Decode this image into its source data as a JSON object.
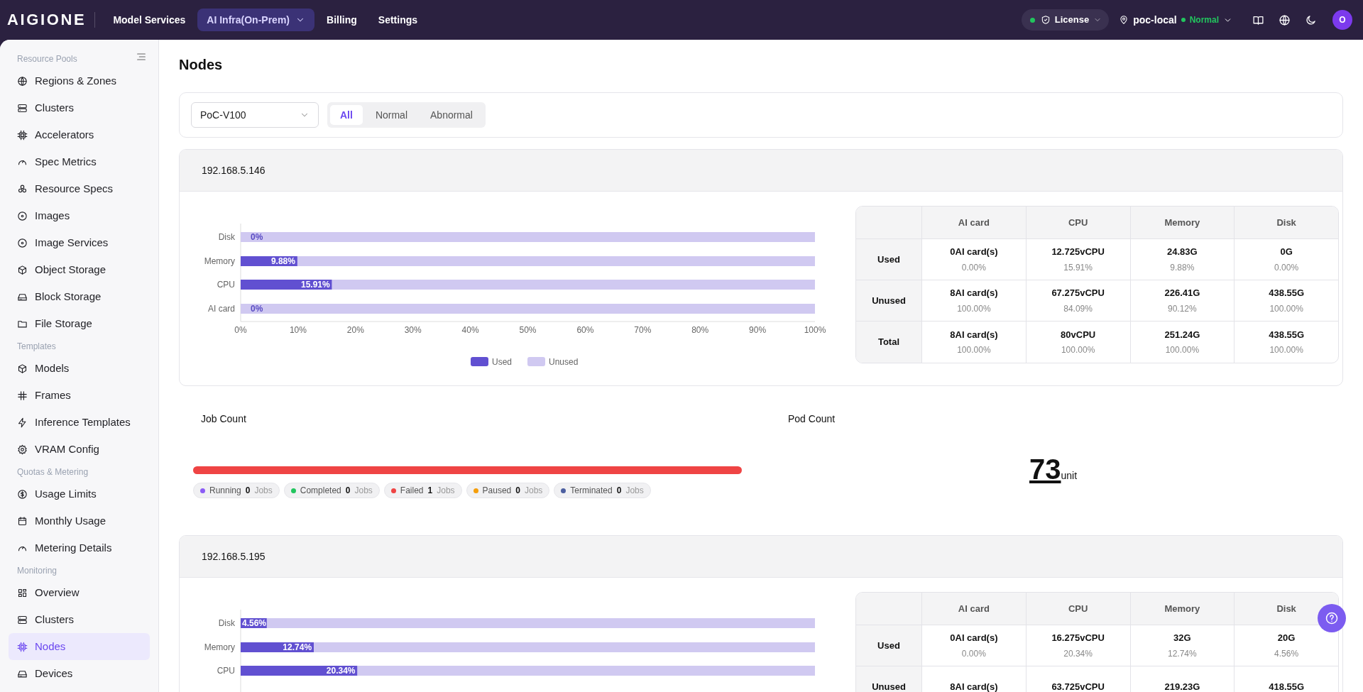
{
  "topbar": {
    "logo": "AIGIONE",
    "nav": [
      {
        "label": "Model Services",
        "selected": false,
        "dropdown": false
      },
      {
        "label": "AI Infra(On-Prem)",
        "selected": true,
        "dropdown": true
      },
      {
        "label": "Billing",
        "selected": false,
        "dropdown": false
      },
      {
        "label": "Settings",
        "selected": false,
        "dropdown": false
      }
    ],
    "license": {
      "label": "License",
      "color": "#22c55e"
    },
    "location": {
      "name": "poc-local",
      "status": "Normal",
      "color": "#22c55e"
    },
    "avatar": "O"
  },
  "sidebar": {
    "sections": [
      {
        "title": "Resource Pools",
        "items": [
          {
            "label": "Regions & Zones",
            "selected": false
          },
          {
            "label": "Clusters",
            "selected": false
          },
          {
            "label": "Accelerators",
            "selected": false
          },
          {
            "label": "Spec Metrics",
            "selected": false
          },
          {
            "label": "Resource Specs",
            "selected": false
          },
          {
            "label": "Images",
            "selected": false
          },
          {
            "label": "Image Services",
            "selected": false
          },
          {
            "label": "Object Storage",
            "selected": false
          },
          {
            "label": "Block Storage",
            "selected": false
          },
          {
            "label": "File Storage",
            "selected": false
          }
        ]
      },
      {
        "title": "Templates",
        "items": [
          {
            "label": "Models",
            "selected": false
          },
          {
            "label": "Frames",
            "selected": false
          },
          {
            "label": "Inference Templates",
            "selected": false
          },
          {
            "label": "VRAM Config",
            "selected": false
          }
        ]
      },
      {
        "title": "Quotas & Metering",
        "items": [
          {
            "label": "Usage Limits",
            "selected": false
          },
          {
            "label": "Monthly Usage",
            "selected": false
          },
          {
            "label": "Metering Details",
            "selected": false
          }
        ]
      },
      {
        "title": "Monitoring",
        "items": [
          {
            "label": "Overview",
            "selected": false
          },
          {
            "label": "Clusters",
            "selected": false
          },
          {
            "label": "Nodes",
            "selected": true
          },
          {
            "label": "Devices",
            "selected": false
          }
        ]
      }
    ]
  },
  "page_title": "Nodes",
  "filter": {
    "select": "PoC-V100",
    "tabs": [
      {
        "label": "All",
        "selected": true
      },
      {
        "label": "Normal",
        "selected": false
      },
      {
        "label": "Abnormal",
        "selected": false
      }
    ]
  },
  "nodes": [
    {
      "ip": "192.168.5.146",
      "chart_data": {
        "type": "bar",
        "orientation": "horizontal",
        "stacked": true,
        "categories": [
          "Disk",
          "Memory",
          "CPU",
          "AI card"
        ],
        "series": [
          {
            "name": "Used",
            "color": "#6150d1",
            "values": [
              0,
              9.88,
              15.91,
              0
            ]
          },
          {
            "name": "Unused",
            "color": "#d0c9f1",
            "values": [
              100,
              90.12,
              84.09,
              100
            ]
          }
        ],
        "value_labels": [
          "0%",
          "9.88%",
          "15.91%",
          "0%"
        ],
        "xlim": [
          0,
          100
        ],
        "legend": "bottom",
        "xticks": [
          {
            "value": 0,
            "label": "0%"
          },
          {
            "value": 10,
            "label": "10%"
          },
          {
            "value": 20,
            "label": "20%"
          },
          {
            "value": 30,
            "label": "30%"
          },
          {
            "value": 40,
            "label": "40%"
          },
          {
            "value": 50,
            "label": "50%"
          },
          {
            "value": 60,
            "label": "60%"
          },
          {
            "value": 70,
            "label": "70%"
          },
          {
            "value": 80,
            "label": "80%"
          },
          {
            "value": 90,
            "label": "90%"
          },
          {
            "value": 100,
            "label": "100%"
          }
        ]
      },
      "table": {
        "columns": [
          "AI card",
          "CPU",
          "Memory",
          "Disk"
        ],
        "rows": [
          {
            "label": "Used",
            "cells": [
              {
                "value": "0AI card(s)",
                "percent": "0.00%"
              },
              {
                "value": "12.725vCPU",
                "percent": "15.91%"
              },
              {
                "value": "24.83G",
                "percent": "9.88%"
              },
              {
                "value": "0G",
                "percent": "0.00%"
              }
            ]
          },
          {
            "label": "Unused",
            "cells": [
              {
                "value": "8AI card(s)",
                "percent": "100.00%"
              },
              {
                "value": "67.275vCPU",
                "percent": "84.09%"
              },
              {
                "value": "226.41G",
                "percent": "90.12%"
              },
              {
                "value": "438.55G",
                "percent": "100.00%"
              }
            ]
          },
          {
            "label": "Total",
            "cells": [
              {
                "value": "8AI card(s)",
                "percent": "100.00%"
              },
              {
                "value": "80vCPU",
                "percent": "100.00%"
              },
              {
                "value": "251.24G",
                "percent": "100.00%"
              },
              {
                "value": "438.55G",
                "percent": "100.00%"
              }
            ]
          }
        ]
      },
      "jobs": {
        "title": "Job Count",
        "statuses": [
          {
            "label": "Running",
            "count": "0",
            "unit": "Jobs",
            "color": "#8b5cf6"
          },
          {
            "label": "Completed",
            "count": "0",
            "unit": "Jobs",
            "color": "#22c55e"
          },
          {
            "label": "Failed",
            "count": "1",
            "unit": "Jobs",
            "color": "#ef4444"
          },
          {
            "label": "Paused",
            "count": "0",
            "unit": "Jobs",
            "color": "#f59e0b"
          },
          {
            "label": "Terminated",
            "count": "0",
            "unit": "Jobs",
            "color": "#4c5fa0"
          }
        ]
      },
      "pods": {
        "title": "Pod Count",
        "value": "73",
        "unit": "unit"
      }
    },
    {
      "ip": "192.168.5.195",
      "chart_data": {
        "type": "bar",
        "orientation": "horizontal",
        "stacked": true,
        "categories": [
          "Disk",
          "Memory",
          "CPU"
        ],
        "series": [
          {
            "color": "#6150d1",
            "values": [
              4.56,
              12.74,
              20.34
            ]
          },
          {
            "color": "#d0c9f1",
            "values": [
              95.44,
              87.26,
              79.66
            ]
          }
        ],
        "value_labels": [
          "4.56%",
          "12.74%",
          "20.34%"
        ],
        "xlim": [
          0,
          100
        ]
      },
      "table": {
        "columns": [
          "AI card",
          "CPU",
          "Memory",
          "Disk"
        ],
        "rows": [
          {
            "label": "Used",
            "cells": [
              {
                "value": "0AI card(s)",
                "percent": "0.00%"
              },
              {
                "value": "16.275vCPU",
                "percent": "20.34%"
              },
              {
                "value": "32G",
                "percent": "12.74%"
              },
              {
                "value": "20G",
                "percent": "4.56%"
              }
            ]
          },
          {
            "label": "Unused",
            "cells": [
              {
                "value": "8AI card(s)"
              },
              {
                "value": "63.725vCPU"
              },
              {
                "value": "219.23G"
              },
              {
                "value": "418.55G"
              }
            ]
          }
        ]
      }
    }
  ]
}
